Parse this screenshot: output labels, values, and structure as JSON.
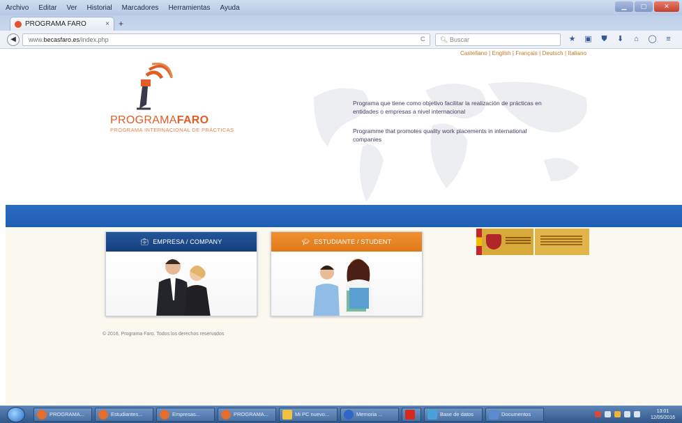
{
  "browser": {
    "menu": [
      "Archivo",
      "Editar",
      "Ver",
      "Historial",
      "Marcadores",
      "Herramientas",
      "Ayuda"
    ],
    "tab_title": "PROGRAMA FARO",
    "tab_close": "×",
    "new_tab": "+",
    "url_prefix": "www.",
    "url_domain": "becasfaro.es",
    "url_path": "/index.php",
    "search_placeholder": "Buscar",
    "back": "◀",
    "reload": "C",
    "toolbar_icons": [
      "star-icon",
      "bookmarks-icon",
      "pocket-icon",
      "download-icon",
      "home-icon",
      "chat-icon",
      "menu-icon"
    ]
  },
  "page": {
    "languages": "Castellano | English | Français | Deutsch | Italiano",
    "logo_name_regular": "PROGRAMA",
    "logo_name_bold": "FARO",
    "logo_subtitle": "PROGRAMA INTERNACIONAL DE PRÁCTICAS",
    "desc_es": "Programa que tiene como objetivo facilitar la realización de prácticas en entidades o empresas a nivel internacional",
    "desc_en": "Programme that promotes quality work placements in international companies",
    "cards": {
      "company_label": "EMPRESA / COMPANY",
      "student_label": "ESTUDIANTE / STUDENT"
    },
    "gov_logo_text": "GOBIERNO DE ESPAÑA",
    "footer": "© 2016, Programa Faro. Todos los derechos reservados"
  },
  "taskbar": {
    "items": [
      {
        "label": "PROGRAMA...",
        "icon": "firefox-icon",
        "color": "#e46d2c"
      },
      {
        "label": "Estudiantes...",
        "icon": "firefox-icon",
        "color": "#e46d2c"
      },
      {
        "label": "Empresas...",
        "icon": "firefox-icon",
        "color": "#e46d2c"
      },
      {
        "label": "PROGRAMA...",
        "icon": "firefox-icon",
        "color": "#e46d2c"
      },
      {
        "label": "Mi PC nuevo...",
        "icon": "folder-icon",
        "color": "#f0c040"
      },
      {
        "label": "Memoria ...",
        "icon": "word-icon",
        "color": "#2f66c8"
      },
      {
        "label": "",
        "icon": "pdf-icon",
        "color": "#d42a20"
      },
      {
        "label": "Base de datos",
        "icon": "db-icon",
        "color": "#4aa0d8"
      },
      {
        "label": "Documentos",
        "icon": "docs-icon",
        "color": "#5a8ad0"
      }
    ],
    "clock_time": "13:01",
    "clock_date": "12/05/2016"
  }
}
